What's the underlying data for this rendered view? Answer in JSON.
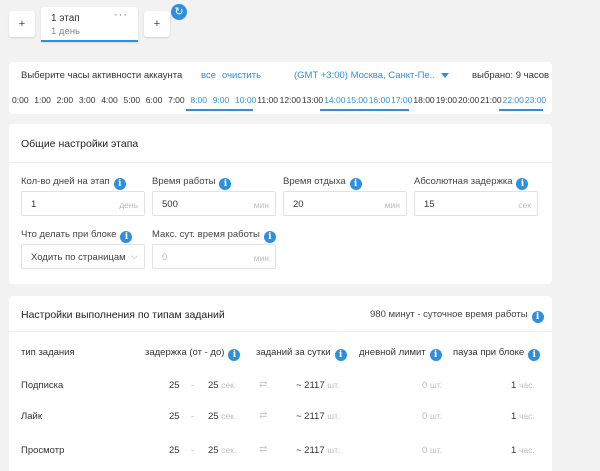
{
  "stages": {
    "add_left": "+",
    "add_right": "+",
    "current": {
      "title": "1 этап",
      "subtitle": "1 день",
      "menu": "···"
    }
  },
  "activity": {
    "label": "Выберите часы активности аккаунта",
    "all": "все",
    "clear": "очистить",
    "timezone": "(GMT +3:00) Москва, Санкт-Пе...",
    "selected": "выбрано: 9 часов",
    "hours": [
      "0:00",
      "1:00",
      "2:00",
      "3:00",
      "4:00",
      "5:00",
      "6:00",
      "7:00",
      "8:00",
      "9:00",
      "10:00",
      "11:00",
      "12:00",
      "13:00",
      "14:00",
      "15:00",
      "16:00",
      "17:00",
      "18:00",
      "19:00",
      "20:00",
      "21:00",
      "22:00",
      "23:00"
    ],
    "selected_hours": [
      8,
      9,
      10,
      14,
      15,
      16,
      17,
      22,
      23
    ]
  },
  "general": {
    "title": "Общие настройки этапа",
    "days_label": "Кол-во дней на этап",
    "days_value": "1",
    "days_unit": "день",
    "work_label": "Время работы",
    "work_value": "500",
    "work_unit": "мин",
    "rest_label": "Время отдыха",
    "rest_value": "20",
    "rest_unit": "мин",
    "delay_label": "Абсолютная задержка",
    "delay_value": "15",
    "delay_unit": "сек",
    "block_label": "Что делать при блоке",
    "block_value": "Ходить по страницам",
    "max_label": "Макс. сут. время работы",
    "max_value": "0",
    "max_unit": "мин"
  },
  "tasks": {
    "title": "Настройки выполнения по типам заданий",
    "daily_time": "980 минут - суточное время работы",
    "headers": {
      "type": "тип задания",
      "delay": "задержка (от - до)",
      "per_day": "заданий за сутки",
      "daily_limit": "дневной лимит",
      "pause": "пауза при блоке"
    },
    "rows": [
      {
        "name": "Подписка",
        "from": "25",
        "dash": "-",
        "to": "25",
        "to_unit": "сек.",
        "per_day": "~ 2117",
        "per_day_unit": "шт.",
        "limit": "0",
        "limit_unit": "шт.",
        "pause": "1",
        "pause_unit": "час."
      },
      {
        "name": "Лайк",
        "from": "25",
        "dash": "-",
        "to": "25",
        "to_unit": "сек.",
        "per_day": "~ 2117",
        "per_day_unit": "шт.",
        "limit": "0",
        "limit_unit": "шт.",
        "pause": "1",
        "pause_unit": "час."
      },
      {
        "name": "Просмотр",
        "from": "25",
        "dash": "-",
        "to": "25",
        "to_unit": "сек.",
        "per_day": "~ 2117",
        "per_day_unit": "шт.",
        "limit": "0",
        "limit_unit": "шт.",
        "pause": "1",
        "pause_unit": "час."
      }
    ]
  },
  "colors": {
    "accent": "#2f8fdd",
    "background": "#f2f2f2",
    "panel": "#ffffff"
  }
}
